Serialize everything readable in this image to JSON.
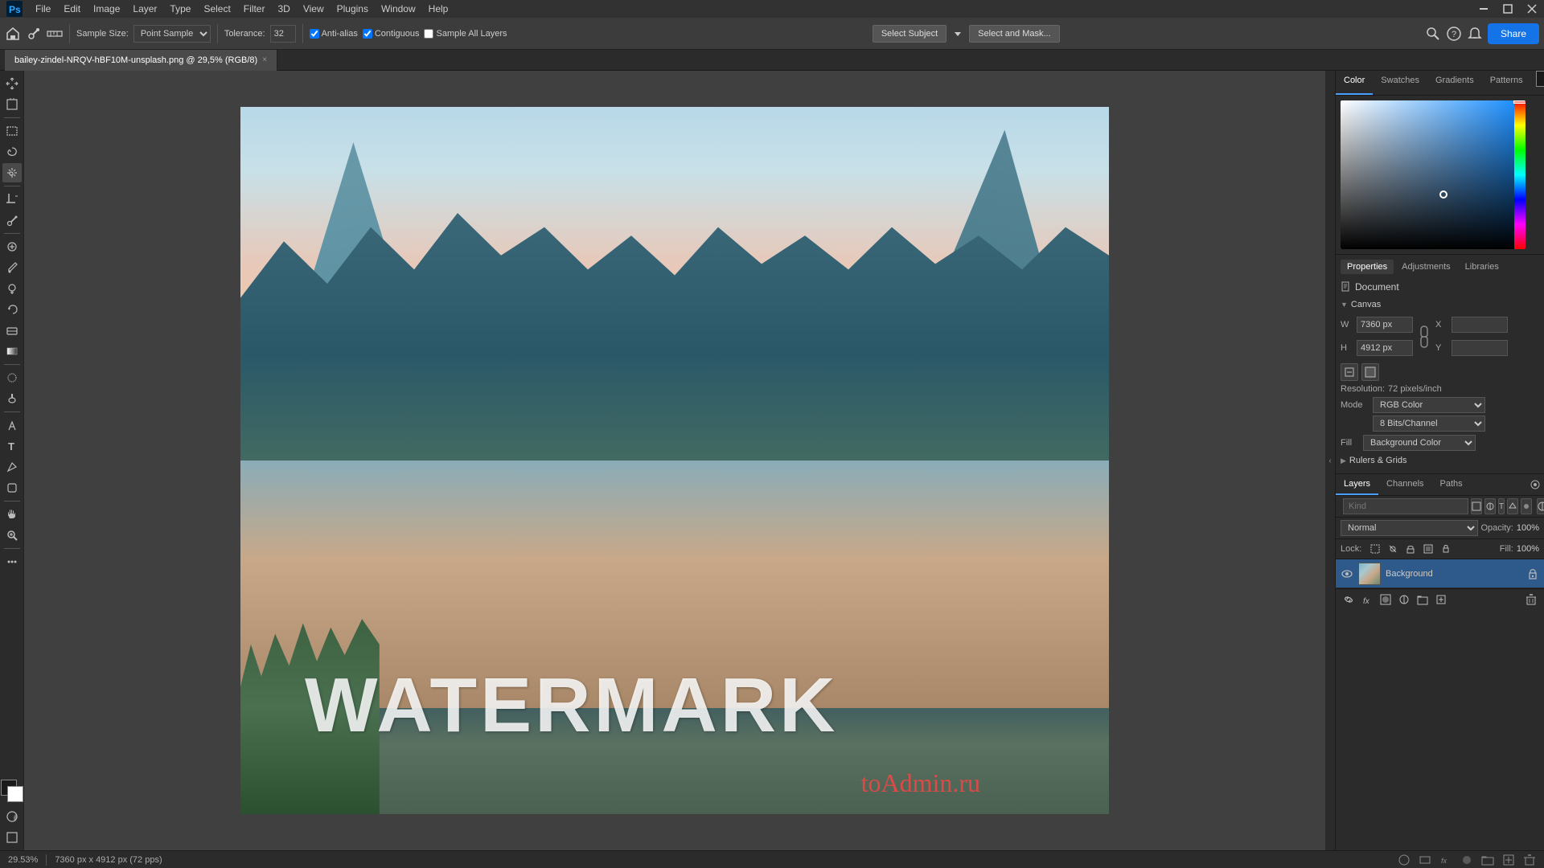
{
  "app": {
    "title": "Adobe Photoshop"
  },
  "menu": {
    "items": [
      "File",
      "Edit",
      "Image",
      "Layer",
      "Type",
      "Select",
      "Filter",
      "3D",
      "View",
      "Plugins",
      "Window",
      "Help"
    ]
  },
  "toolbar": {
    "sample_size_label": "Sample Size:",
    "sample_size_value": "Point Sample",
    "tolerance_label": "Tolerance:",
    "tolerance_value": "32",
    "anti_alias_label": "Anti-alias",
    "contiguous_label": "Contiguous",
    "sample_all_label": "Sample All Layers",
    "select_subject_btn": "Select Subject",
    "select_mask_btn": "Select and Mask...",
    "share_btn": "Share"
  },
  "tab": {
    "filename": "bailey-zindel-NRQV-hBF10M-unsplash.png @ 29,5% (RGB/8)",
    "close": "×"
  },
  "canvas": {
    "watermark": "WATERMARK",
    "zoom": "29.53%",
    "dimensions": "7360 px × 4912 px (72 pps)"
  },
  "color_panel": {
    "tabs": [
      "Color",
      "Swatches",
      "Gradients",
      "Patterns"
    ],
    "active_tab": "Color"
  },
  "swatches_panel": {
    "label": "Swatches"
  },
  "properties_panel": {
    "tabs": [
      "Properties",
      "Adjustments",
      "Libraries"
    ],
    "active_tab": "Properties",
    "document_label": "Document",
    "canvas_section": "Canvas",
    "w_label": "W",
    "w_value": "7360 px",
    "h_label": "H",
    "h_value": "4912 px",
    "x_label": "X",
    "y_label": "Y",
    "resolution_label": "Resolution:",
    "resolution_value": "72 pixels/inch",
    "mode_label": "Mode",
    "mode_value": "RGB Color",
    "bit_depth_value": "8 Bits/Channel",
    "fill_label": "Fill",
    "fill_value": "Background Color",
    "rulers_grids_section": "Rulers & Grids"
  },
  "layers_panel": {
    "tabs": [
      "Layers",
      "Channels",
      "Paths"
    ],
    "active_tab": "Layers",
    "search_placeholder": "Kind",
    "blend_mode": "Normal",
    "opacity_label": "Opacity:",
    "opacity_value": "100%",
    "fill_label": "Fill:",
    "fill_value": "100%",
    "layers": [
      {
        "name": "Background",
        "visible": true,
        "locked": true,
        "type": "image"
      }
    ]
  },
  "status_bar": {
    "zoom": "29.53%",
    "dimensions": "7360 px x 4912 px (72 pps)"
  },
  "icons": {
    "move": "✛",
    "artboard": "⊞",
    "select_rect": "⬜",
    "select_ellipse": "⬭",
    "lasso": "⌖",
    "magic_wand": "⊹",
    "crop": "⊡",
    "eyedropper": "⌇",
    "healing": "⊕",
    "brush": "✏",
    "clone": "⊗",
    "history_brush": "↺",
    "eraser": "◻",
    "gradient": "◫",
    "blur": "◉",
    "dodge": "○",
    "pen": "✒",
    "type": "T",
    "path": "⊿",
    "shape": "⬡",
    "hand": "✋",
    "zoom_tool": "🔍",
    "more": "...",
    "fg_bg": "◩",
    "quick_mask": "⊞",
    "screen_mode": "⊟"
  }
}
